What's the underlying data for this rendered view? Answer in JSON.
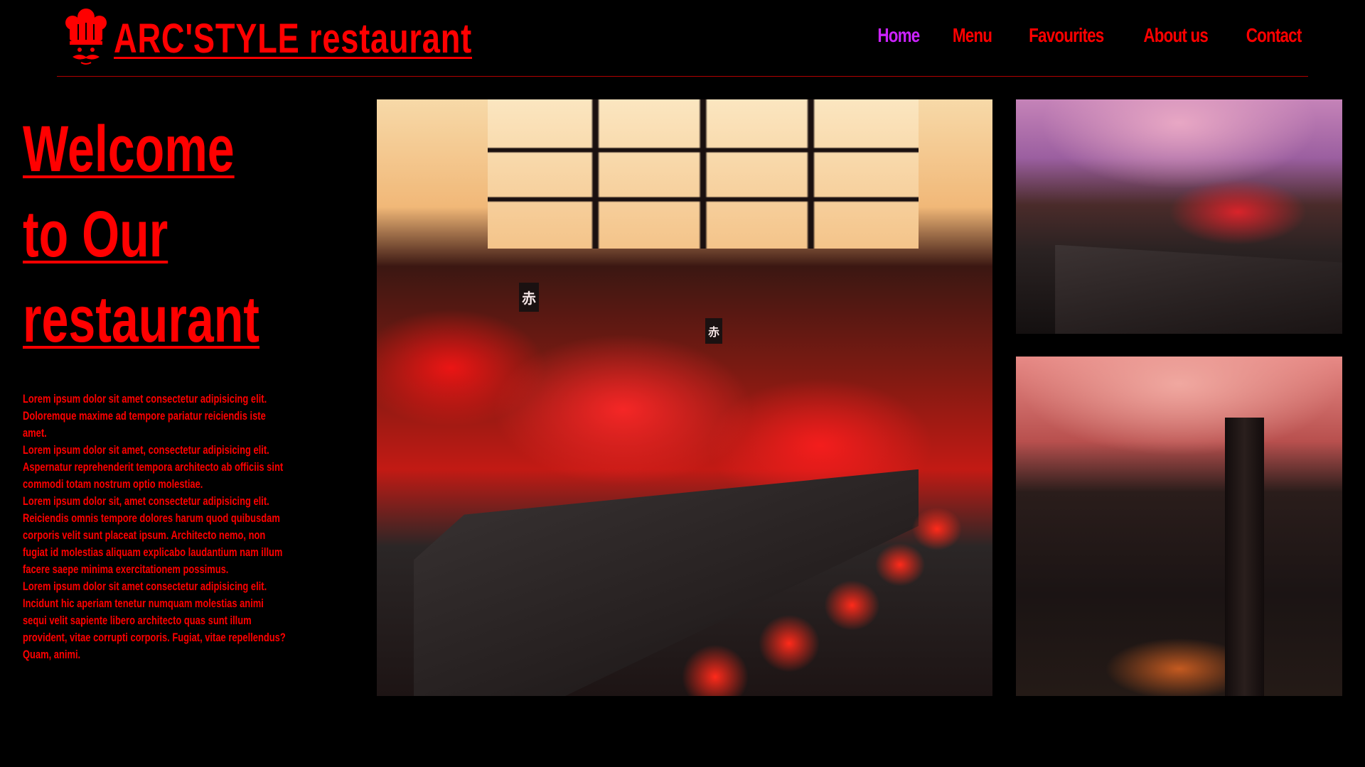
{
  "header": {
    "brand": "ARC'STYLE restaurant",
    "nav": [
      {
        "label": "Home",
        "active": true
      },
      {
        "label": "Menu",
        "active": false
      },
      {
        "label": "Favourites",
        "active": false
      },
      {
        "label": "About us",
        "active": false
      },
      {
        "label": "Contact",
        "active": false
      }
    ]
  },
  "hero": {
    "title_lines": [
      "Welcome",
      "to Our",
      "restaurant"
    ],
    "paragraphs": [
      "Lorem ipsum dolor sit amet consectetur adipisicing elit. Doloremque maxime ad tempore pariatur reiciendis iste amet.",
      "Lorem ipsum dolor sit amet, consectetur adipisicing elit. Aspernatur reprehenderit tempora architecto ab officiis sint commodi totam nostrum optio molestiae.",
      "Lorem ipsum dolor sit, amet consectetur adipisicing elit. Reiciendis omnis tempore dolores harum quod quibusdam corporis velit sunt placeat ipsum. Architecto nemo, non fugiat id molestias aliquam explicabo laudantium nam illum facere saepe minima exercitationem possimus.",
      "Lorem ipsum dolor sit amet consectetur adipisicing elit. Incidunt hic aperiam tenetur numquam molestias animi sequi velit sapiente libero architecto quas sunt illum provident, vitae corrupti corporis. Fugiat, vitae repellendus? Quam, animi."
    ]
  },
  "photos": {
    "main_sign": "赤",
    "main_sign_2": "赤"
  },
  "colors": {
    "background": "#000000",
    "text": "#ff0000",
    "nav_active": "#cc22ff"
  },
  "icons": {
    "logo": "chef-hat-mustache-icon"
  }
}
